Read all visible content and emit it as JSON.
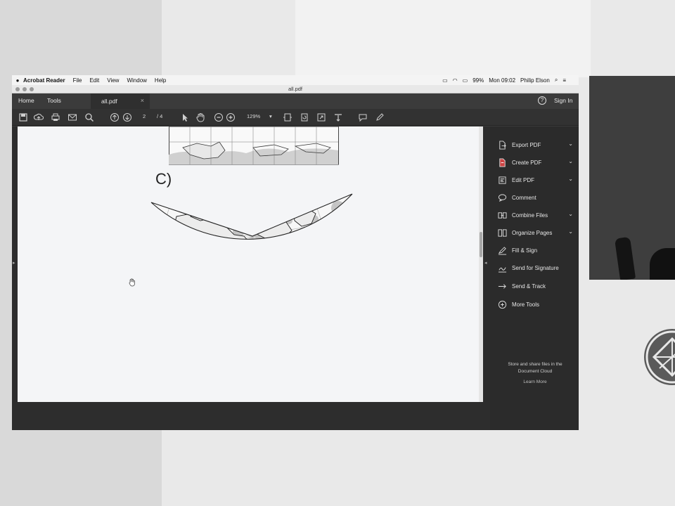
{
  "menubar": {
    "app_name": "Acrobat Reader",
    "items": [
      "File",
      "Edit",
      "View",
      "Window",
      "Help"
    ],
    "battery": "99%",
    "clock": "Mon 09:02",
    "user": "Philip Elson"
  },
  "window": {
    "title": "all.pdf"
  },
  "tabs": {
    "home": "Home",
    "tools": "Tools",
    "document": "all.pdf",
    "close": "×",
    "help": "?",
    "sign_in": "Sign In"
  },
  "toolbar": {
    "page_current": "2",
    "page_total": "/ 4",
    "zoom": "129%",
    "zoom_arrow": "▾"
  },
  "document": {
    "figure_label": "C)"
  },
  "sidebar": {
    "items": [
      {
        "label": "Export PDF",
        "icon": "export-pdf-icon",
        "expandable": true
      },
      {
        "label": "Create PDF",
        "icon": "create-pdf-icon",
        "expandable": true
      },
      {
        "label": "Edit PDF",
        "icon": "edit-pdf-icon",
        "expandable": true
      },
      {
        "label": "Comment",
        "icon": "comment-icon",
        "expandable": false
      },
      {
        "label": "Combine Files",
        "icon": "combine-files-icon",
        "expandable": true
      },
      {
        "label": "Organize Pages",
        "icon": "organize-pages-icon",
        "expandable": true
      },
      {
        "label": "Fill & Sign",
        "icon": "fill-sign-icon",
        "expandable": false
      },
      {
        "label": "Send for Signature",
        "icon": "send-signature-icon",
        "expandable": false
      },
      {
        "label": "Send & Track",
        "icon": "send-track-icon",
        "expandable": false
      },
      {
        "label": "More Tools",
        "icon": "more-tools-icon",
        "expandable": false
      }
    ],
    "chevron": "⌄",
    "promo": "Store and share files in the Document Cloud",
    "learn_more": "Learn More"
  },
  "dock": {
    "icons": [
      "finder-icon",
      "chrome-icon",
      "system-preferences-icon",
      "terminal-icon",
      "utility-icon",
      "acrobat-icon",
      "document-icon",
      "trash-icon"
    ]
  },
  "colors": {
    "app_dark": "#3b3b3b",
    "sidebar": "#2b2b2b",
    "page": "#f4f5f7",
    "menubar": "#f4f4f4"
  }
}
